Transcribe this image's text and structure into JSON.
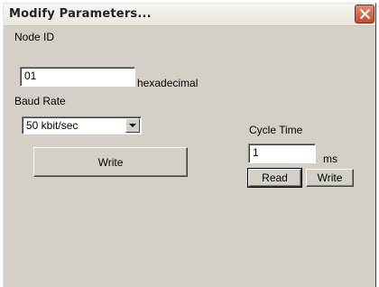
{
  "window": {
    "title": "Modify Parameters..."
  },
  "node_id": {
    "label": "Node ID",
    "value": "01",
    "unit": "hexadecimal"
  },
  "baud_rate": {
    "label": "Baud Rate",
    "selected": "50 kbit/sec"
  },
  "left_write_label": "Write",
  "cycle_time": {
    "label": "Cycle Time",
    "value": "1",
    "unit": "ms",
    "read_label": "Read",
    "write_label": "Write"
  }
}
